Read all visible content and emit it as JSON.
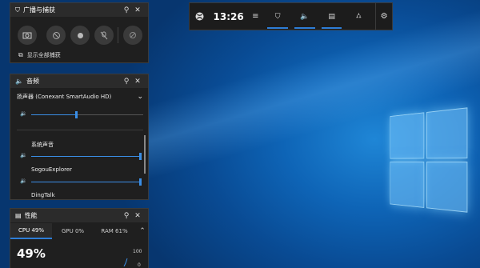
{
  "capture": {
    "title": "广播与捕获",
    "show_all_label": "显示全部捕获"
  },
  "audio": {
    "title": "音频",
    "device": "扬声器 (Conexant SmartAudio HD)",
    "master_level": 0.4,
    "apps": [
      {
        "name": "系统声音",
        "level": 1.0
      },
      {
        "name": "SogouExplorer",
        "level": 1.0
      },
      {
        "name": "DingTalk"
      }
    ]
  },
  "performance": {
    "title": "性能",
    "tabs": [
      {
        "label": "CPU",
        "value": "49%"
      },
      {
        "label": "GPU",
        "value": "0%"
      },
      {
        "label": "RAM",
        "value": "61%"
      }
    ],
    "big_value": "49%",
    "axis_max": "100",
    "axis_min": "0"
  },
  "topbar": {
    "time": "13:26"
  },
  "icons": {
    "xbox": "xbox-logo-icon",
    "menu": "menu-icon",
    "capture": "capture-widget-icon",
    "audio": "audio-widget-icon",
    "performance": "performance-widget-icon",
    "social": "xbox-social-icon",
    "settings": "gear-icon"
  },
  "colors": {
    "accent": "#2e7dd7",
    "panel": "#1f1f1f",
    "header": "#2b2b2b"
  }
}
